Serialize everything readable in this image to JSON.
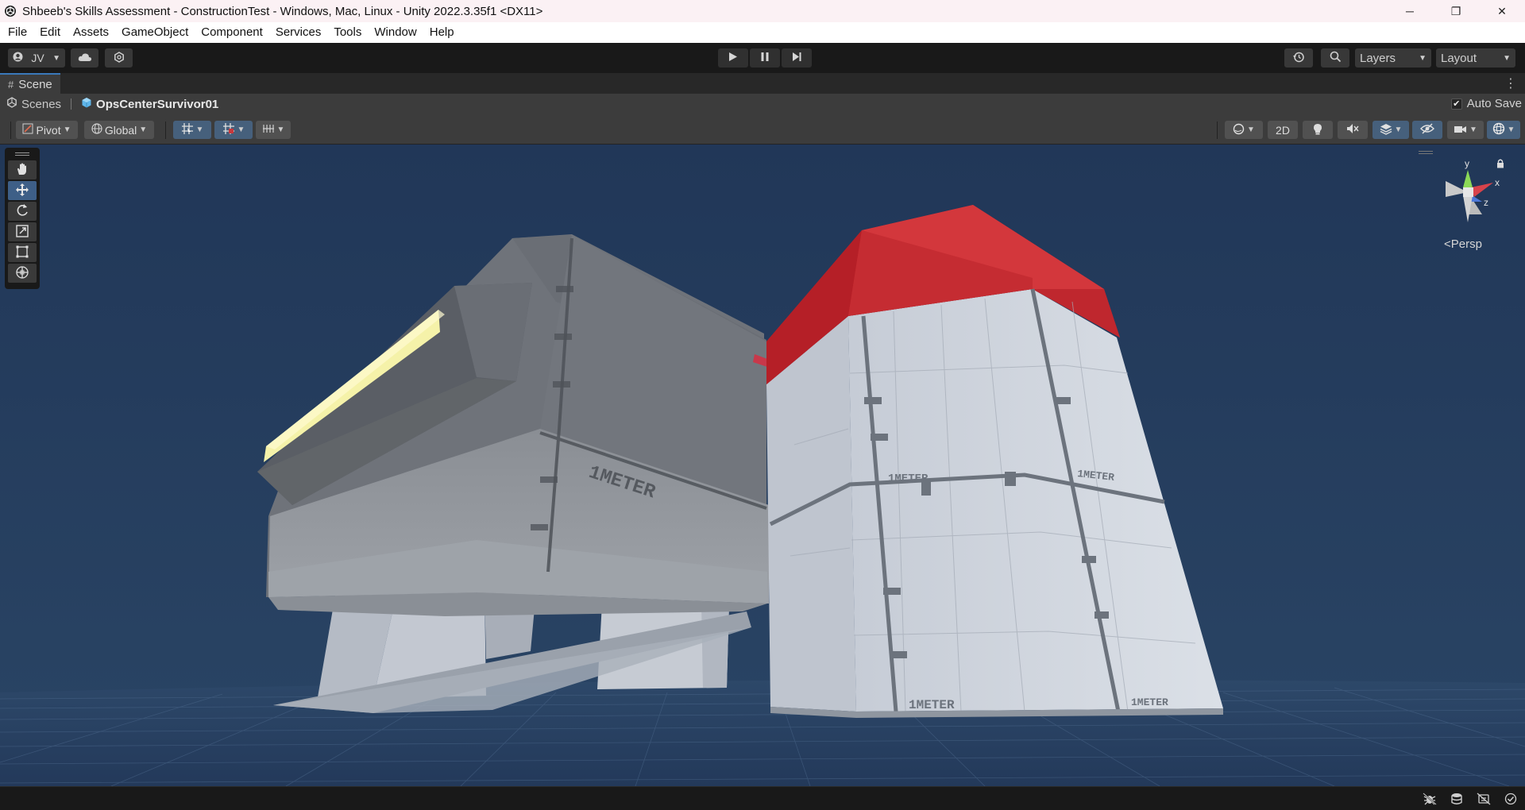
{
  "window": {
    "title": "Shbeeb's Skills Assessment - ConstructionTest - Windows, Mac, Linux - Unity 2022.3.35f1 <DX11>",
    "minimize": "─",
    "restore": "❐",
    "close": "✕"
  },
  "menu": [
    "File",
    "Edit",
    "Assets",
    "GameObject",
    "Component",
    "Services",
    "Tools",
    "Window",
    "Help"
  ],
  "toolbar": {
    "account": "JV",
    "layers": "Layers",
    "layout": "Layout"
  },
  "scene_tab": {
    "label": "Scene"
  },
  "breadcrumb": {
    "root": "Scenes",
    "current": "OpsCenterSurvivor01"
  },
  "autosave": {
    "label": "Auto Save",
    "checked": true
  },
  "scene_toolbar": {
    "pivot": "Pivot",
    "global": "Global",
    "mode_2d": "2D"
  },
  "gizmo": {
    "y": "y",
    "x": "x",
    "z": "z",
    "projection": "Persp"
  },
  "scene": {
    "decal_text": "1METER",
    "colors": {
      "sky": "#22395a",
      "grid": "#3d5878",
      "tower_top_red": "#c8242b",
      "tower_body": "#c9ced6",
      "block_gray": "#6d7178",
      "light_panel": "#f5f2a9"
    }
  },
  "tools": [
    "hand-tool",
    "move-tool",
    "rotate-tool",
    "scale-tool",
    "rect-tool",
    "transform-tool"
  ]
}
